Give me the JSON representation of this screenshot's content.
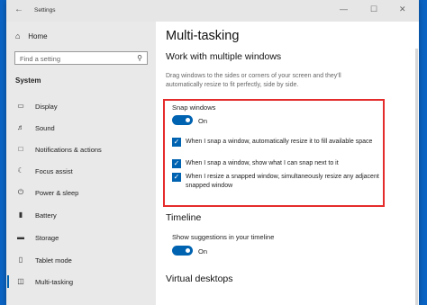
{
  "window": {
    "title": "Settings",
    "back_icon": "arrow-left",
    "minimize_glyph": "—",
    "maximize_glyph": "☐",
    "close_glyph": "✕"
  },
  "sidebar": {
    "home_label": "Home",
    "search_placeholder": "Find a setting",
    "category": "System",
    "items": [
      {
        "label": "Display",
        "icon": "display-icon"
      },
      {
        "label": "Sound",
        "icon": "sound-icon"
      },
      {
        "label": "Notifications & actions",
        "icon": "notifications-icon"
      },
      {
        "label": "Focus assist",
        "icon": "moon-icon"
      },
      {
        "label": "Power & sleep",
        "icon": "power-icon"
      },
      {
        "label": "Battery",
        "icon": "battery-icon"
      },
      {
        "label": "Storage",
        "icon": "storage-icon"
      },
      {
        "label": "Tablet mode",
        "icon": "tablet-icon"
      },
      {
        "label": "Multi-tasking",
        "icon": "multitasking-icon",
        "active": true
      }
    ]
  },
  "main": {
    "title": "Multi-tasking",
    "section1": {
      "heading": "Work with multiple windows",
      "description": "Drag windows to the sides or corners of your screen and they'll automatically resize to fit perfectly, side by side.",
      "snap_label": "Snap windows",
      "snap_state": "On",
      "options": [
        {
          "text": "When I snap a window, automatically resize it to fill available space",
          "checked": true
        },
        {
          "text": "When I snap a window, show what I can snap next to it",
          "checked": true
        },
        {
          "text": "When I resize a snapped window, simultaneously resize any adjacent snapped window",
          "checked": true
        }
      ]
    },
    "section2": {
      "heading": "Timeline",
      "label": "Show suggestions in your timeline",
      "state": "On"
    },
    "section3": {
      "heading": "Virtual desktops"
    }
  },
  "colors": {
    "accent": "#0063b1",
    "highlight_box": "#e52c2c",
    "desktop": "#0b64c4"
  }
}
